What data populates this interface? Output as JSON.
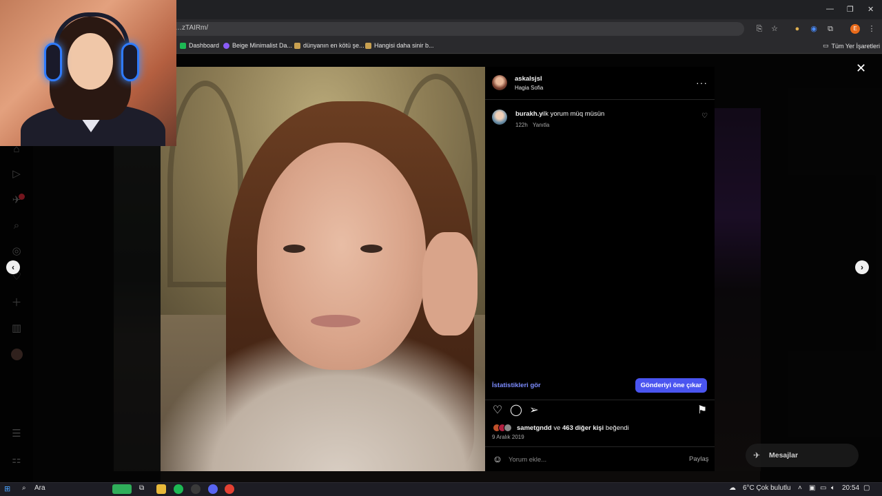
{
  "browser": {
    "url": "…zTAIRm/",
    "bookmarks": [
      {
        "label": "Dashboard",
        "color": "#1db954"
      },
      {
        "label": "Beige Minimalist Da...",
        "color": "#8a5cf6"
      },
      {
        "label": "dünyanın en kötü şe...",
        "color": "#c8a050"
      },
      {
        "label": "Hangisi daha sinir b...",
        "color": "#c8a050"
      }
    ],
    "all_bookmarks": "Tüm Yer İşaretleri",
    "profile_initial": "E"
  },
  "post": {
    "username": "askalsjsl",
    "location": "Hagia Sofia",
    "more_label": "···",
    "comment": {
      "username": "burakh.y",
      "text": "ilk yorum müq müsün",
      "time": "122h",
      "reply": "Yanıtla"
    },
    "stats_link": "İstatistikleri gör",
    "boost_button": "Gönderiyi öne çıkar",
    "likes": {
      "first_user": "sametgndd",
      "connector": " ve ",
      "others": "463 diğer kişi",
      "suffix": " beğendi"
    },
    "date": "9 Aralık 2019",
    "comment_placeholder": "Yorum ekle...",
    "share_label": "Paylaş"
  },
  "messages": {
    "label": "Mesajlar"
  },
  "taskbar": {
    "search": "Ara",
    "weather": "6°C  Çok bulutlu",
    "time": "20:54"
  },
  "colors": {
    "accent": "#4a55f0",
    "link": "#7c8cff",
    "notification": "#ff3040"
  }
}
